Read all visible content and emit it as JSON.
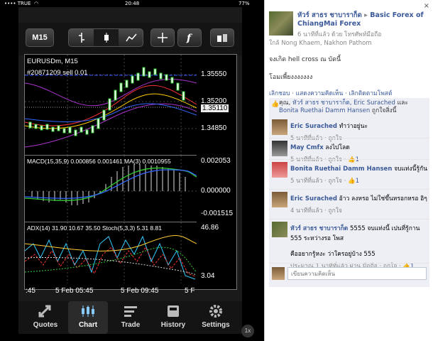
{
  "status": {
    "carrier": "•••• TRUE",
    "wifi": "◠",
    "time": "20:48",
    "battery": "77%"
  },
  "toolbar": {
    "timeframe": "M15"
  },
  "chart": {
    "symbol_line": "EURUSDm, M15",
    "order_line": "#20871209 sell 0.01",
    "price_labels": [
      "1.35550",
      "1.35200",
      "1.35110",
      "1.34850"
    ],
    "macd_label": "MACD(15,35,9) 0.000856 0.001461 MA(3) 0.0010955",
    "macd_axis": [
      "0.002053",
      "0.000000",
      "-0.001515"
    ],
    "adx_label": "ADX(14) 31.90 10.67 35.50 Stoch(5,3,3) 5.31 8.81",
    "adx_axis": [
      "46.86",
      "3.04"
    ],
    "time_labels": [
      ":45",
      "5 Feb 05:45",
      "5 Feb 09:45",
      "5 F"
    ]
  },
  "tabs": [
    {
      "label": "Quotes",
      "icon": "quotes-icon"
    },
    {
      "label": "Chart",
      "icon": "chart-icon"
    },
    {
      "label": "Trade",
      "icon": "trade-icon"
    },
    {
      "label": "History",
      "icon": "history-icon"
    },
    {
      "label": "Settings",
      "icon": "settings-icon"
    }
  ],
  "zoom_badge": "1x",
  "post": {
    "author": "หัวร์ สาธร ชาบาราก็ด",
    "arrow": "▸",
    "group": "Basic Forex of ChiangMai Forex",
    "meta": "6 นาทีที่แล้ว ด้วย โทรศัพท์มือถือ",
    "location": "ใกล้ Nong Khaem, Nakhon Pathom",
    "body1": "จงเกิด hell cross ณ บัดนี้",
    "body2": "โอมเพี้ยงงงงงงง",
    "actions": "เลิกชอบ · แสดงความคิดเห็น · เลิกติดตามโพสต์",
    "likes_prefix": "คุณ, ",
    "likes_names": "หัวร์ สาธร ชาบาราก็ด, Eric Surached",
    "likes_and": " และ ",
    "likes_names2": "Bonita Ruethai Damm Hansen",
    "likes_suffix": " ถูกใจสิ่งนี้"
  },
  "comments": [
    {
      "name": "Eric Surached",
      "text": " ทำว่าอยู่นะ",
      "meta": "5 นาทีที่แล้ว · ถูกใจ",
      "likes": ""
    },
    {
      "name": "May Cmfx",
      "text": " ลงไปโลด",
      "meta": "5 นาทีที่แล้ว · ถูกใจ · ",
      "likes": "1"
    },
    {
      "name": "Bonita Ruethai Damm Hansen",
      "text": " จบแท่งนี้รู้กัน",
      "meta": "5 นาทีที่แล้ว · ถูกใจ · ",
      "likes": "1"
    },
    {
      "name": "Eric Surached",
      "text": " อ้าว ลงหรอ ไม่ใช่ขึ้นหรอกหรอ อิๆ",
      "meta": "4 นาทีที่แล้ว · ถูกใจ",
      "likes": ""
    },
    {
      "name": "หัวร์ สาธร ชาบาราก็ด",
      "text": " 5555 จบแท่งนี้ เปนที่รู้กาน 555 ระหว่างรอ โพส",
      "text2": "คืออยากรู้หงะ ว่าใครอยู่บ้าง 555",
      "meta": "ประมาณ 1 นาทีที่แล้ว ผ่าน มือถือ · ถูกใจ · ",
      "likes": "1"
    }
  ],
  "comment_input": {
    "placeholder": "เขียนความคิดเห็น"
  },
  "close": "×"
}
